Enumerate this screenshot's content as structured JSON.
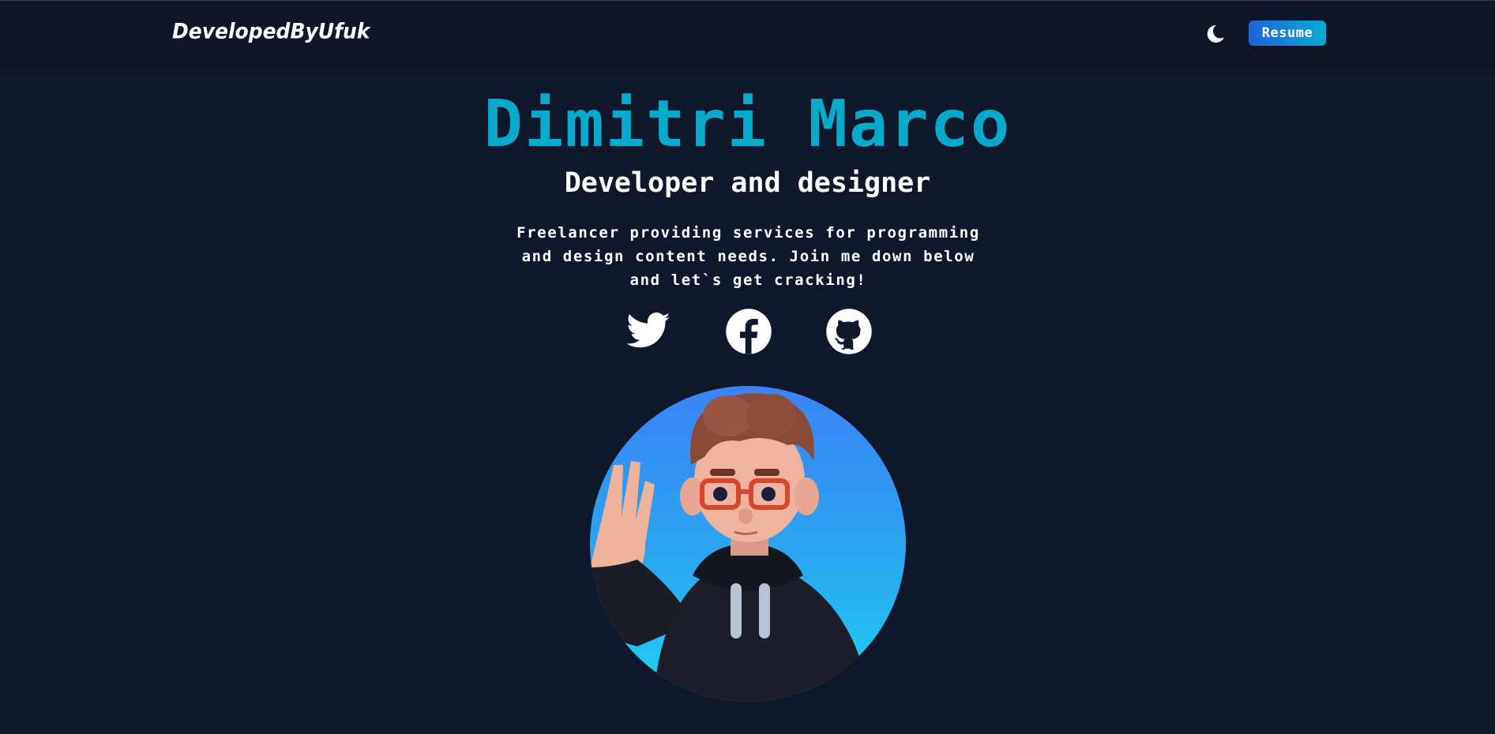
{
  "nav": {
    "logo": "DevelopedByUfuk",
    "theme_toggle_icon": "moon-icon",
    "resume_label": "Resume"
  },
  "hero": {
    "name": "Dimitri Marco",
    "role": "Developer and designer",
    "description": "Freelancer providing services for programming and design content needs. Join me down below and let`s get cracking!"
  },
  "socials": [
    {
      "icon": "twitter-icon"
    },
    {
      "icon": "facebook-icon"
    },
    {
      "icon": "github-icon"
    }
  ],
  "colors": {
    "background": "#0f172a",
    "accent": "#08aacb",
    "button_gradient_start": "#1d63dc",
    "button_gradient_end": "#09aad3"
  }
}
